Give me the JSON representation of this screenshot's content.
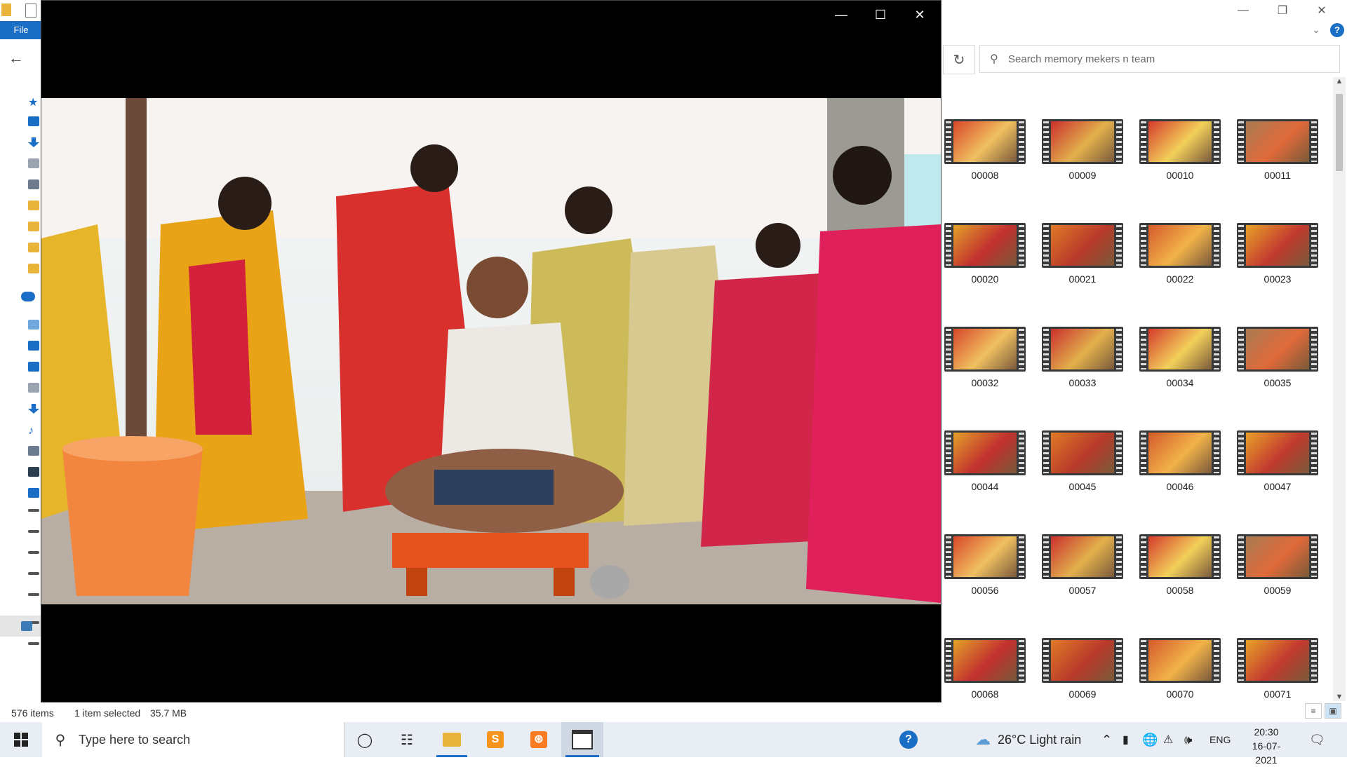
{
  "explorer": {
    "file_tab": "File",
    "search_placeholder": "Search memory mekers n team",
    "status": {
      "items": "576 items",
      "selected": "1 item selected",
      "size": "35.7 MB"
    },
    "help": "?",
    "thumbnails": [
      "00008",
      "00009",
      "00010",
      "00011",
      "00020",
      "00021",
      "00022",
      "00023",
      "00032",
      "00033",
      "00034",
      "00035",
      "00044",
      "00045",
      "00046",
      "00047",
      "00056",
      "00057",
      "00058",
      "00059",
      "00068",
      "00069",
      "00070",
      "00071"
    ]
  },
  "taskbar": {
    "search_placeholder": "Type here to search",
    "weather": "26°C  Light rain",
    "language": "ENG",
    "time": "20:30",
    "date": "16-07-2021"
  },
  "colors": {
    "accent": "#1a6ec5",
    "player_bg": "#000000",
    "taskbar_bg": "#e9eef4"
  }
}
